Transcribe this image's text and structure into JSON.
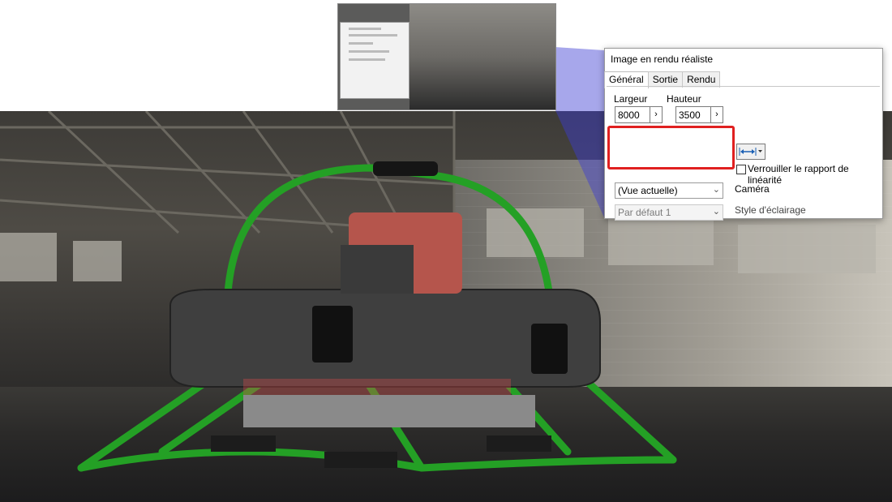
{
  "dialog": {
    "title": "Image en rendu réaliste",
    "tabs": [
      "Général",
      "Sortie",
      "Rendu"
    ],
    "width_label": "Largeur",
    "height_label": "Hauteur",
    "width_value": "8000",
    "height_value": "3500",
    "lock_ratio_label": "Verrouiller le rapport de linéarité",
    "camera_select": "(Vue actuelle)",
    "camera_label": "Caméra",
    "lighting_select": "Par défaut 1",
    "lighting_label": "Style d'éclairage"
  },
  "colors": {
    "highlight": "#e02020",
    "wedge": "#3c3cd2",
    "frame_green": "#24a025",
    "module_red": "#b5554c"
  },
  "icons": {
    "ratio_button": "horizontal-arrow-icon",
    "dropdown": "chevron-down-icon",
    "spinner": "chevron-right-icon"
  }
}
